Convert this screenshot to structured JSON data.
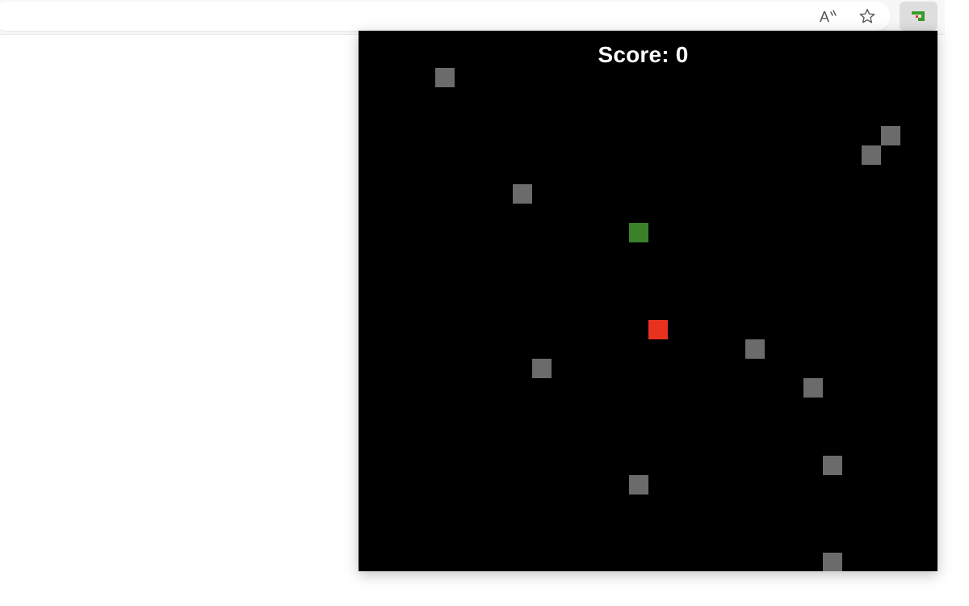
{
  "browser": {
    "read_aloud_icon": "read-aloud-icon",
    "favorite_icon": "star-icon",
    "extension_icon": "snake-extension-icon"
  },
  "game": {
    "score_label": "Score: 0",
    "score": 0,
    "colors": {
      "background": "#000000",
      "obstacle": "#6b6b6b",
      "snake": "#3a8128",
      "food": "#e8321e",
      "text": "#ffffff"
    },
    "grid_cell_size": 24,
    "snake": {
      "col": 14,
      "row": 10
    },
    "food": {
      "col": 15,
      "row": 15
    },
    "obstacles": [
      {
        "col": 4,
        "row": 2
      },
      {
        "col": 27,
        "row": 5
      },
      {
        "col": 26,
        "row": 6
      },
      {
        "col": 8,
        "row": 8
      },
      {
        "col": 20,
        "row": 16
      },
      {
        "col": 9,
        "row": 17
      },
      {
        "col": 23,
        "row": 18
      },
      {
        "col": 24,
        "row": 22
      },
      {
        "col": 14,
        "row": 23
      },
      {
        "col": 24,
        "row": 27
      }
    ]
  }
}
